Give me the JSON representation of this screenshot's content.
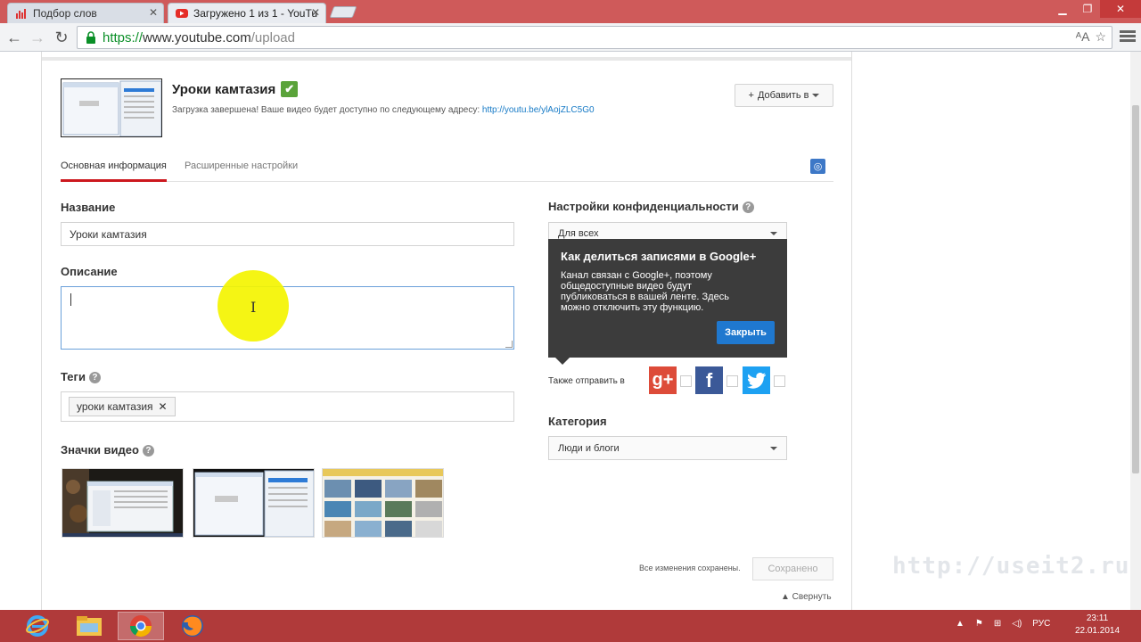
{
  "browser": {
    "tabs": [
      {
        "label": "Подбор слов",
        "active": false
      },
      {
        "label": "Загружено 1 из 1 - YouTu",
        "active": true
      }
    ],
    "url_scheme": "https://",
    "url_host": "www.youtube.com",
    "url_path": "/upload"
  },
  "video": {
    "title": "Уроки камтазия",
    "status_text": "Загрузка завершена! Ваше видео будет доступно по следующему адресу:",
    "status_link": "http://youtu.be/ylAojZLC5G0"
  },
  "toolbar": {
    "add_to_label": "Добавить в"
  },
  "page_tabs": [
    {
      "label": "Основная информация",
      "active": true
    },
    {
      "label": "Расширенные настройки",
      "active": false
    }
  ],
  "form": {
    "title_label": "Название",
    "title_value": "Уроки камтазия",
    "description_label": "Описание",
    "tags_label": "Теги",
    "tags": [
      "уроки камтазия"
    ],
    "thumbnails_label": "Значки видео",
    "privacy_label": "Настройки конфиденциальности",
    "privacy_value": "Для всех",
    "share_label": "Также отправить в",
    "category_label": "Категория",
    "category_value": "Люди и блоги"
  },
  "tooltip": {
    "title": "Как делиться записями в Google+",
    "body": "Канал связан с Google+, поэтому общедоступные видео будут публиковаться в вашей ленте. Здесь можно отключить эту функцию.",
    "close_label": "Закрыть"
  },
  "footer": {
    "saved_text": "Все изменения сохранены.",
    "saved_button": "Сохранено",
    "collapse_label": "▲ Свернуть"
  },
  "watermark": "http://useit2.ru",
  "taskbar": {
    "lang": "РУС",
    "time": "23:11",
    "date": "22.01.2014"
  },
  "colors": {
    "accent_red": "#cc181e",
    "link_blue": "#167ac6",
    "check_green": "#5aa33a",
    "button_blue": "#1f78cf",
    "gplus": "#dd4b39",
    "facebook": "#3b5998",
    "twitter": "#1da1f2"
  }
}
